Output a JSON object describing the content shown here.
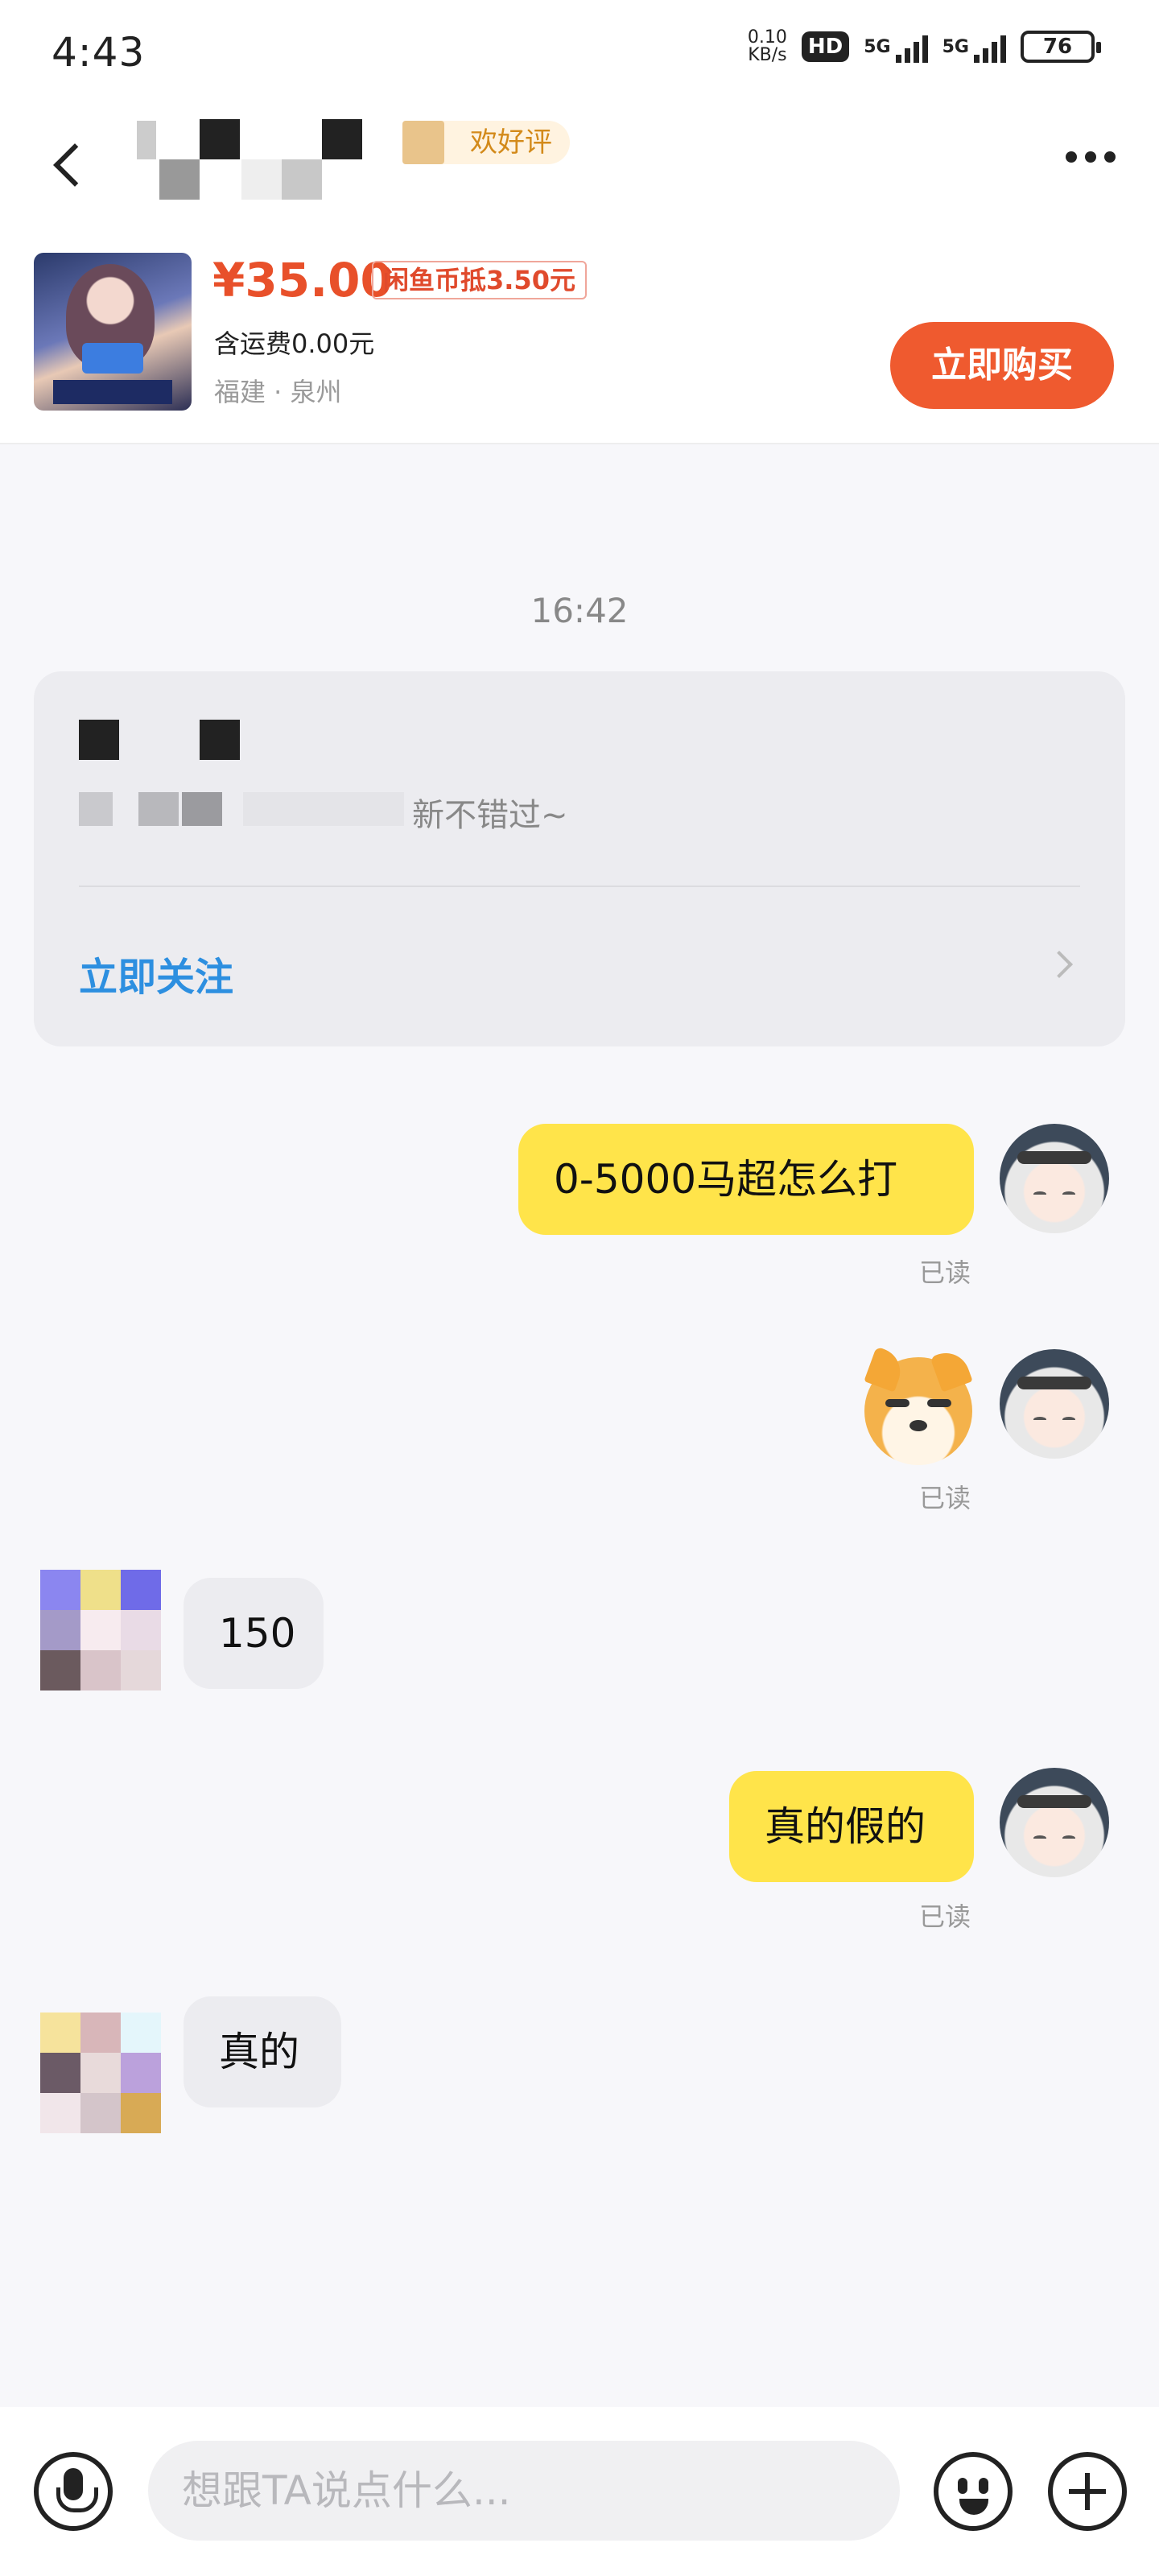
{
  "status_bar": {
    "time": "4:43",
    "net_speed_value": "0.10",
    "net_speed_unit": "KB/s",
    "hd_label": "HD",
    "signal_1": "5G",
    "signal_2": "5G",
    "battery": "76"
  },
  "header": {
    "seller_badge": "欢好评",
    "icons": [
      "back-icon",
      "more-icon"
    ]
  },
  "product": {
    "price": "¥35.00",
    "coin_discount": "闲鱼币抵3.50元",
    "shipping": "含运费0.00元",
    "location": "福建 · 泉州",
    "buy_button": "立即购买"
  },
  "chat": {
    "timestamp": "16:42",
    "follow_card": {
      "desc_visible": "新不错过~",
      "follow_label": "立即关注"
    },
    "messages": [
      {
        "from": "me",
        "text": "0-5000马超怎么打",
        "status": "已读"
      },
      {
        "from": "me",
        "sticker": "doge-sticker",
        "status": "已读"
      },
      {
        "from": "them",
        "text": "150"
      },
      {
        "from": "me",
        "text": "真的假的",
        "status": "已读"
      },
      {
        "from": "them",
        "text": "真的"
      }
    ]
  },
  "input_bar": {
    "placeholder": "想跟TA说点什么...",
    "icons": [
      "mic-icon",
      "emoji-icon",
      "plus-icon"
    ]
  },
  "colors": {
    "accent_orange": "#ef5a2f",
    "my_bubble": "#ffe44a",
    "their_bubble": "#ececf0",
    "link_blue": "#2d8fe0"
  }
}
